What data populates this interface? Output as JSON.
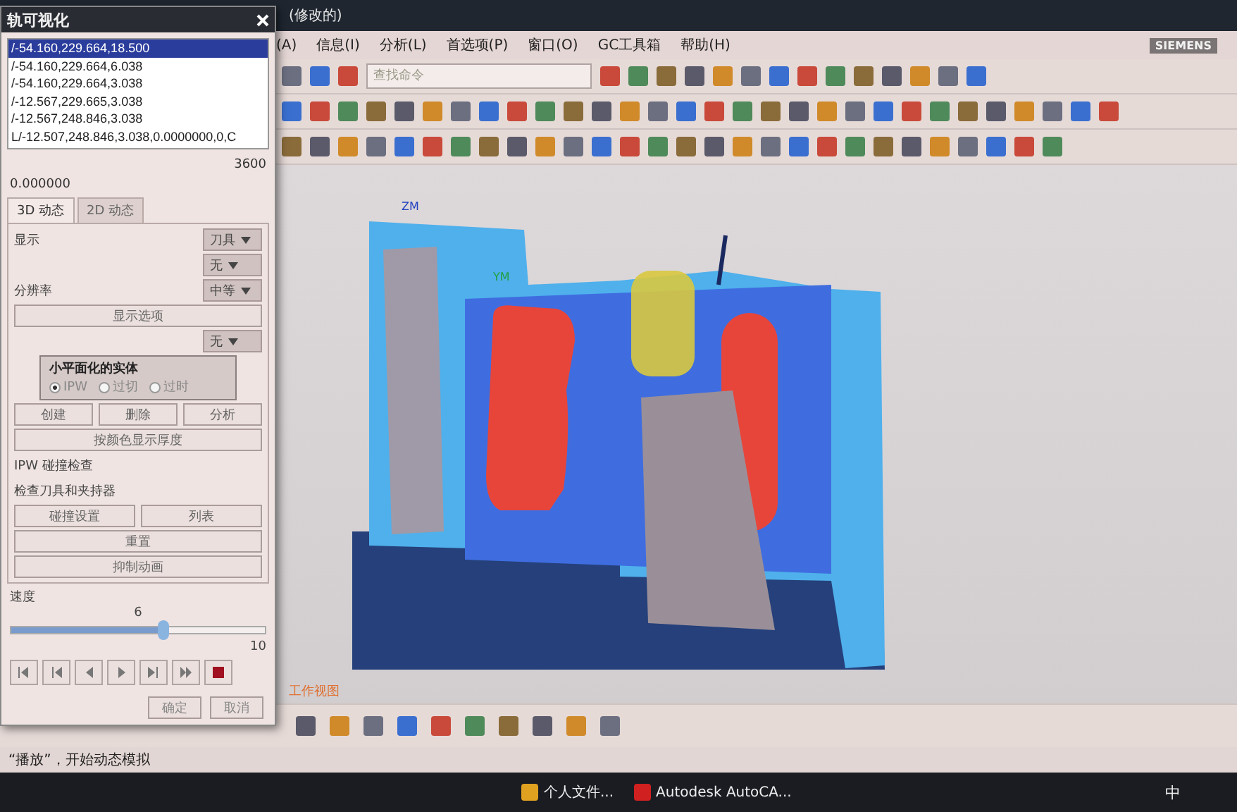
{
  "app": {
    "title": "(修改的)",
    "brand": "SIEMENS",
    "search": {
      "placeholder": "查找命令"
    },
    "menu": [
      {
        "label": "(A)"
      },
      {
        "label": "信息(I)"
      },
      {
        "label": "分析(L)"
      },
      {
        "label": "首选项(P)"
      },
      {
        "label": "窗口(O)"
      },
      {
        "label": "GC工具箱"
      },
      {
        "label": "帮助(H)"
      }
    ]
  },
  "dialog": {
    "title": "轨可视化",
    "list": [
      {
        "text": "/-54.160,229.664,18.500",
        "selected": true
      },
      {
        "text": "/-54.160,229.664,6.038",
        "selected": false
      },
      {
        "text": "/-54.160,229.664,3.038",
        "selected": false
      },
      {
        "text": "/-12.567,229.665,3.038",
        "selected": false
      },
      {
        "text": "/-12.567,248.846,3.038",
        "selected": false
      },
      {
        "text": "L/-12.507,248.846,3.038,0.0000000,0,C",
        "selected": false
      }
    ],
    "range_max": "3600",
    "value": "0.000000",
    "tabs": [
      {
        "label": "3D 动态",
        "selected": true
      },
      {
        "label": "2D 动态",
        "selected": false
      }
    ],
    "rows": [
      {
        "kind": "dropdown",
        "label": "显示",
        "value": "刀具"
      },
      {
        "kind": "dropdown",
        "value": "无"
      },
      {
        "kind": "dropdown",
        "label": "分辨率",
        "value": "中等"
      },
      {
        "kind": "button",
        "labels": [
          "显示选项"
        ]
      },
      {
        "kind": "dropdown",
        "value": "无"
      },
      {
        "kind": "group",
        "title": "小平面化的实体",
        "radios": [
          {
            "label": "IPW",
            "selected": true
          },
          {
            "label": "过切",
            "selected": false
          },
          {
            "label": "过时",
            "selected": false
          }
        ]
      },
      {
        "kind": "button",
        "labels": [
          "创建",
          "删除",
          "分析"
        ]
      },
      {
        "kind": "button",
        "labels": [
          "按颜色显示厚度"
        ]
      },
      {
        "kind": "text",
        "label": "IPW 碰撞检查"
      },
      {
        "kind": "text",
        "label": "检查刀具和夹持器"
      },
      {
        "kind": "button",
        "labels": [
          "碰撞设置",
          "列表"
        ]
      },
      {
        "kind": "button",
        "labels": [
          "重置"
        ]
      },
      {
        "kind": "button",
        "labels": [
          "抑制动画"
        ]
      }
    ],
    "speed": {
      "label": "速度",
      "value": "6",
      "max": "10",
      "level": 0.6
    },
    "footer": [
      "确定",
      "取消"
    ]
  },
  "viewport": {
    "axis_labels": [
      "ZM",
      "YM"
    ],
    "view_label": "工作视图"
  },
  "status_text": "“播放”，开始动态模拟",
  "taskbar": {
    "items": [
      {
        "label": "个人文件..."
      },
      {
        "label": "Autodesk AutoCA..."
      }
    ],
    "ime": "中"
  }
}
